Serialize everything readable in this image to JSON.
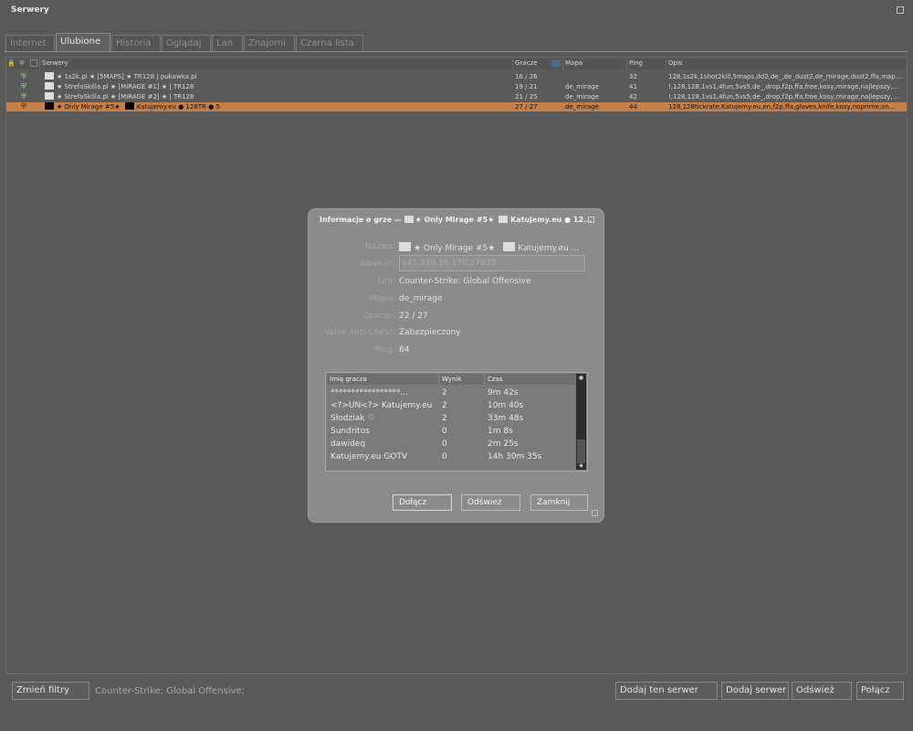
{
  "window": {
    "title": "Serwery"
  },
  "tabs": [
    {
      "label": "Internet"
    },
    {
      "label": "Ulubione"
    },
    {
      "label": "Historia"
    },
    {
      "label": "Oglądaj"
    },
    {
      "label": "Lan"
    },
    {
      "label": "Znajomi"
    },
    {
      "label": "Czarna lista"
    }
  ],
  "active_tab": "Ulubione",
  "columns": {
    "servers": "Serwery",
    "players": "Gracze",
    "map": "Mapa",
    "ping": "Ping",
    "description": "Opis"
  },
  "servers": [
    {
      "name": "★ 1s2k.pl ★ [5MAPS] ★ TR128 | pukawka.pl",
      "players": "16 / 26",
      "map": "",
      "ping": "32",
      "desc": "128,1s2k,1shot2kill,5maps,dd2,de_,de_dust2,de_mirage,dust2,ffa,map...",
      "selected": false,
      "icon_color": "#dddddd"
    },
    {
      "name": "★ StrefaSkilla.pl ★ [MIRAGE #1] ★ | TR128",
      "players": "19 / 21",
      "map": "de_mirage",
      "ping": "41",
      "desc": "!,128,128,1vs1,4fun,5vs5,de_,drop,f2p,ffa,free,kosy,mirage,najlepszy,...",
      "selected": false,
      "icon_color": "#dddddd"
    },
    {
      "name": "★ StrefaSkilla.pl ★ [MIRAGE #2] ★ | TR128",
      "players": "21 / 25",
      "map": "de_mirage",
      "ping": "42",
      "desc": "!,128,128,1vs1,4fun,5vs5,de_,drop,f2p,ffa,free,kosy,mirage,najlepszy,...",
      "selected": false,
      "icon_color": "#dddddd"
    },
    {
      "name": "★ Only Mirage #5★",
      "name2": "Katujemy.eu ● 128TR ● 5",
      "players": "27 / 27",
      "map": "de_mirage",
      "ping": "44",
      "desc": "128,128tickrate,Katujemy.eu,en,f2p,ffa,gloves,knife,kosy,noprime,on...",
      "selected": true,
      "icon_color": "#000000"
    }
  ],
  "bottom": {
    "filter_button": "Zmień filtry",
    "status": "Counter-Strike: Global Offensive;",
    "add_this": "Dodaj ten serwer",
    "add_server": "Dodaj serwer",
    "refresh": "Odśwież",
    "connect": "Połącz"
  },
  "dialog": {
    "title": "Informacje o grze — ",
    "title_name1": "★ Only Mirage #5★",
    "title_name2": "Katujemy.eu ● 12...",
    "labels": {
      "name": "Nazwa:",
      "ip": "Adres IP:",
      "game": "Gra:",
      "map": "Mapa:",
      "players": "Gracze:",
      "vac": "Valve Anti-Cheat:",
      "ping": "Ping:"
    },
    "values": {
      "name1": "★ Only Mirage #5★",
      "name2": "Katujemy.eu ...",
      "ip": "145.239.16.170:27035",
      "game": "Counter-Strike: Global Offensive",
      "map": "de_mirage",
      "players": "22 / 27",
      "vac": "Zabezpieczony",
      "ping": "64"
    },
    "player_columns": {
      "name": "Imię gracza",
      "score": "Wynik",
      "time": "Czas"
    },
    "players": [
      {
        "name": "*****************...",
        "score": "2",
        "time": "9m 42s"
      },
      {
        "name": "<?>UN<?> Katujemy.eu",
        "score": "2",
        "time": "10m 40s"
      },
      {
        "name": "Słodziak ♡",
        "score": "2",
        "time": "33m 48s"
      },
      {
        "name": "Sundritos",
        "score": "0",
        "time": "1m 8s"
      },
      {
        "name": "dawideq",
        "score": "0",
        "time": "2m 25s"
      },
      {
        "name": "Katujemy.eu GOTV",
        "score": "0",
        "time": "14h 30m 35s"
      }
    ],
    "buttons": {
      "join": "Dołącz",
      "refresh": "Odśwież",
      "close": "Zamknij"
    }
  }
}
